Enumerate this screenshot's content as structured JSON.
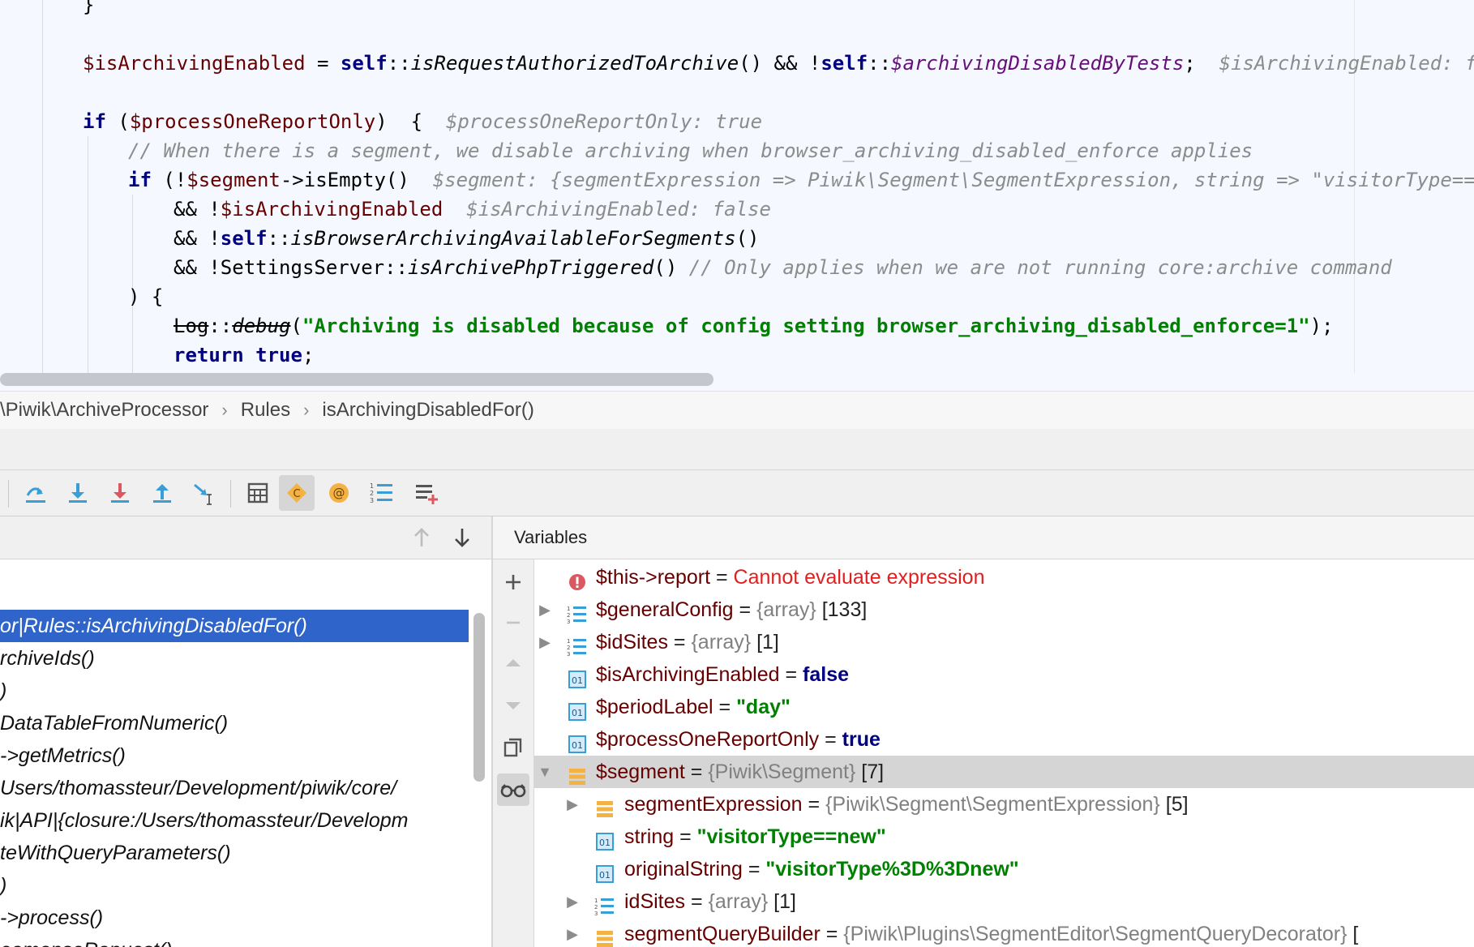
{
  "editor": {
    "lines": {
      "l0": "}",
      "l1_var": "$isArchivingEnabled",
      "l1_eq": " = ",
      "l1_self1": "self",
      "l1_dc1": "::",
      "l1_fn": "isRequestAuthorizedToArchive",
      "l1_mid": "() && !",
      "l1_self2": "self",
      "l1_dc2": "::",
      "l1_field": "$archivingDisabledByTests",
      "l1_end": ";",
      "l1_hint": "$isArchivingEnabled: false",
      "l2_if": "if",
      "l2_open": " (",
      "l2_var": "$processOneReportOnly",
      "l2_close": ")  {",
      "l2_hint": "$processOneReportOnly: true",
      "l3_comment": "// When there is a segment, we disable archiving when browser_archiving_disabled_enforce applies",
      "l4_if": "if",
      "l4_open": " (!",
      "l4_var": "$segment",
      "l4_call": "->isEmpty()",
      "l4_hint": "$segment: {segmentExpression => Piwik\\Segment\\SegmentExpression, string => \"visitorType==new\"",
      "l5_op": "&& !",
      "l5_var": "$isArchivingEnabled",
      "l5_hint": "$isArchivingEnabled: false",
      "l6_op": "&& !",
      "l6_self": "self",
      "l6_dc": "::",
      "l6_fn": "isBrowserArchivingAvailableForSegments",
      "l6_end": "()",
      "l7_op": "&& !SettingsServer::",
      "l7_fn": "isArchivePhpTriggered",
      "l7_end": "() ",
      "l7_comment": "// Only applies when we are not running core:archive command",
      "l8": ") {",
      "l9_cls": "Log",
      "l9_dc": "::",
      "l9_fn": "debug",
      "l9_open": "(",
      "l9_str": "\"Archiving is disabled because of config setting browser_archiving_disabled_enforce=1\"",
      "l9_end": ");",
      "l10_kw1": "return",
      "l10_kw2": "true",
      "l10_end": ";"
    }
  },
  "breadcrumb": {
    "ns": "\\Piwik\\ArchiveProcessor",
    "cls": "Rules",
    "method": "isArchivingDisabledFor()",
    "sep": "›"
  },
  "toolbar": {
    "buttons": [
      "step-over-icon",
      "step-into-icon",
      "force-step-into-icon",
      "step-out-icon",
      "run-to-cursor-icon",
      "evaluate-expression-icon",
      "collect-classes-icon",
      "watches-icon",
      "frames-list-icon",
      "add-breakpoint-icon"
    ]
  },
  "frames": {
    "items": [
      "or|Rules::isArchivingDisabledFor()",
      "rchiveIds()",
      ")",
      "DataTableFromNumeric()",
      "->getMetrics()",
      "Users/thomassteur/Development/piwik/core/",
      "ik|API|{closure:/Users/thomassteur/Developm",
      "teWithQueryParameters()",
      ")",
      "->process()",
      "eamonseRanuest()"
    ]
  },
  "variables": {
    "title": "Variables",
    "rows": [
      {
        "name": "$this->report",
        "eq": " = ",
        "value": "Cannot evaluate expression"
      },
      {
        "name": "$generalConfig",
        "eq": " = ",
        "type": "{array}",
        "count": " [133]"
      },
      {
        "name": "$idSites",
        "eq": " = ",
        "type": "{array}",
        "count": " [1]"
      },
      {
        "name": "$isArchivingEnabled",
        "eq": " = ",
        "value": "false"
      },
      {
        "name": "$periodLabel",
        "eq": " = ",
        "value": "\"day\""
      },
      {
        "name": "$processOneReportOnly",
        "eq": " = ",
        "value": "true"
      },
      {
        "name": "$segment",
        "eq": " = ",
        "type": "{Piwik\\Segment}",
        "count": " [7]"
      },
      {
        "name": "segmentExpression",
        "eq": " = ",
        "type": "{Piwik\\Segment\\SegmentExpression}",
        "count": " [5]"
      },
      {
        "name": "string",
        "eq": " = ",
        "value": "\"visitorType==new\""
      },
      {
        "name": "originalString",
        "eq": " = ",
        "value": "\"visitorType%3D%3Dnew\""
      },
      {
        "name": "idSites",
        "eq": " = ",
        "type": "{array}",
        "count": " [1]"
      },
      {
        "name": "segmentQueryBuilder",
        "eq": " = ",
        "type": "{Piwik\\Plugins\\SegmentEditor\\SegmentQueryDecorator}",
        "count": " ["
      }
    ]
  },
  "colors": {
    "selection": "#2f65ca",
    "keyword": "#000080",
    "variable": "#660000",
    "string": "#008000",
    "error": "#e02020"
  }
}
